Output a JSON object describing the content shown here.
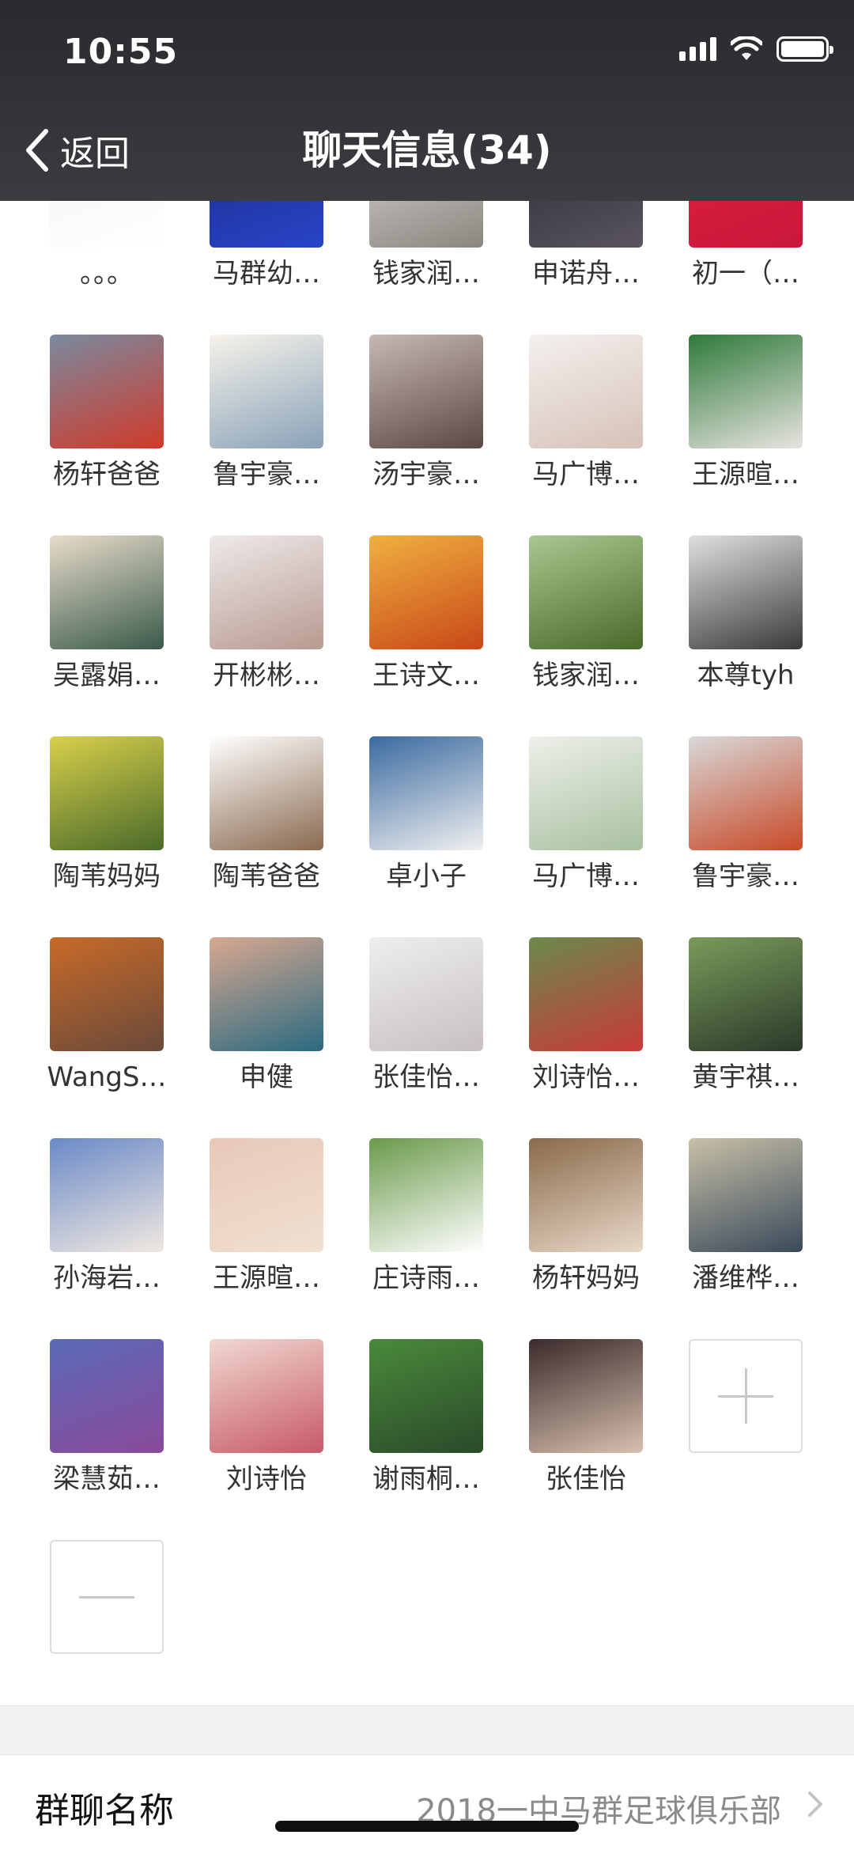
{
  "status_bar": {
    "time": "10:55"
  },
  "nav": {
    "back_label": "返回",
    "title": "聊天信息(34)"
  },
  "members": [
    {
      "name": "。。。",
      "colors": [
        "#f4f4f4",
        "#ffffff"
      ]
    },
    {
      "name": "马群幼…",
      "colors": [
        "#1d2d8a",
        "#2844c8"
      ]
    },
    {
      "name": "钱家润…",
      "colors": [
        "#d8d4cf",
        "#8a8680"
      ]
    },
    {
      "name": "申诺舟…",
      "colors": [
        "#2a2a30",
        "#5a5560"
      ]
    },
    {
      "name": "初一（…",
      "colors": [
        "#e02040",
        "#c8183a"
      ]
    },
    {
      "name": "杨轩爸爸",
      "colors": [
        "#7a8aa0",
        "#d03a2a"
      ]
    },
    {
      "name": "鲁宇豪…",
      "colors": [
        "#f6f3ea",
        "#8aa2b8"
      ]
    },
    {
      "name": "汤宇豪…",
      "colors": [
        "#c8b8b2",
        "#5a4845"
      ]
    },
    {
      "name": "马广博…",
      "colors": [
        "#f4f0ee",
        "#d6c2b8"
      ]
    },
    {
      "name": "王源暄…",
      "colors": [
        "#2e7a3a",
        "#e8e4e0"
      ]
    },
    {
      "name": "吴露娟…",
      "colors": [
        "#e8dccb",
        "#3a5a4a"
      ]
    },
    {
      "name": "开彬彬…",
      "colors": [
        "#eeeaea",
        "#b89a90"
      ]
    },
    {
      "name": "王诗文…",
      "colors": [
        "#f0b040",
        "#c84818"
      ]
    },
    {
      "name": "钱家润…",
      "colors": [
        "#a8c890",
        "#4a6a2a"
      ]
    },
    {
      "name": "本尊tyh",
      "colors": [
        "#e0e0e0",
        "#3a3a3a"
      ]
    },
    {
      "name": "陶苇妈妈",
      "colors": [
        "#d8d04a",
        "#4a6a2a"
      ]
    },
    {
      "name": "陶苇爸爸",
      "colors": [
        "#ffffff",
        "#8a6a50"
      ]
    },
    {
      "name": "卓小子",
      "colors": [
        "#3a6aa0",
        "#f0f0f0"
      ]
    },
    {
      "name": "马广博…",
      "colors": [
        "#eef0ea",
        "#a8c0a0"
      ]
    },
    {
      "name": "鲁宇豪…",
      "colors": [
        "#d8d8d8",
        "#c84a28"
      ]
    },
    {
      "name": "WangS…",
      "colors": [
        "#c86a28",
        "#6a4a3a"
      ]
    },
    {
      "name": "申健",
      "colors": [
        "#d8a890",
        "#2a6a80"
      ]
    },
    {
      "name": "张佳怡…",
      "colors": [
        "#eeeeee",
        "#c8c0c0"
      ]
    },
    {
      "name": "刘诗怡…",
      "colors": [
        "#6a8a4a",
        "#c83a3a"
      ]
    },
    {
      "name": "黄宇祺…",
      "colors": [
        "#7a9a5a",
        "#2a3a2a"
      ]
    },
    {
      "name": "孙海岩…",
      "colors": [
        "#6a8ac8",
        "#f0e8e0"
      ]
    },
    {
      "name": "王源暄…",
      "colors": [
        "#e8c8b8",
        "#f0e0d0"
      ]
    },
    {
      "name": "庄诗雨…",
      "colors": [
        "#6a9a4a",
        "#ffffff"
      ]
    },
    {
      "name": "杨轩妈妈",
      "colors": [
        "#8a6a4a",
        "#e8d8c8"
      ]
    },
    {
      "name": "潘维桦…",
      "colors": [
        "#c8c0a8",
        "#3a4a5a"
      ]
    },
    {
      "name": "梁慧茹…",
      "colors": [
        "#5a6ab8",
        "#8a4a9a"
      ]
    },
    {
      "name": "刘诗怡",
      "colors": [
        "#f0d8d0",
        "#c85a6a"
      ]
    },
    {
      "name": "谢雨桐…",
      "colors": [
        "#4a8a3a",
        "#2a4a2a"
      ]
    },
    {
      "name": "张佳怡",
      "colors": [
        "#3a2a2a",
        "#d8c0b0"
      ]
    }
  ],
  "actions": {
    "add": "add-member",
    "remove": "remove-member"
  },
  "group_name_row": {
    "label": "群聊名称",
    "value": "2018一中马群足球俱乐部"
  }
}
